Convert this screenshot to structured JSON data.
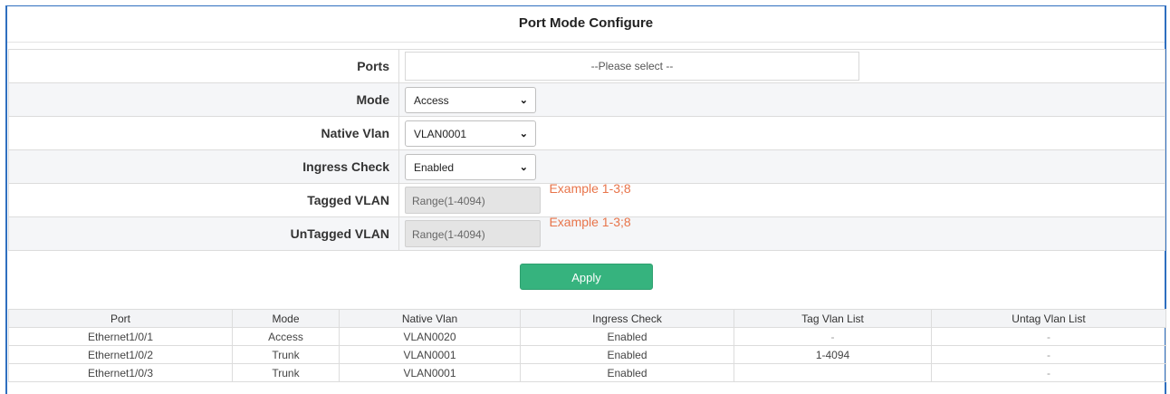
{
  "title": "Port Mode Configure",
  "form": {
    "ports": {
      "label": "Ports",
      "placeholder": "--Please select --"
    },
    "mode": {
      "label": "Mode",
      "value": "Access"
    },
    "native_vlan": {
      "label": "Native Vlan",
      "value": "VLAN0001"
    },
    "ingress_check": {
      "label": "Ingress Check",
      "value": "Enabled"
    },
    "tagged_vlan": {
      "label": "Tagged VLAN",
      "placeholder": "Range(1-4094)",
      "example": "Example 1-3;8"
    },
    "untagged_vlan": {
      "label": "UnTagged VLAN",
      "placeholder": "Range(1-4094)",
      "example": "Example 1-3;8"
    }
  },
  "apply_label": "Apply",
  "table": {
    "headers": [
      "Port",
      "Mode",
      "Native Vlan",
      "Ingress Check",
      "Tag Vlan List",
      "Untag Vlan List"
    ],
    "rows": [
      [
        "Ethernet1/0/1",
        "Access",
        "VLAN0020",
        "Enabled",
        "-",
        "-"
      ],
      [
        "Ethernet1/0/2",
        "Trunk",
        "VLAN0001",
        "Enabled",
        "1-4094",
        "-"
      ],
      [
        "Ethernet1/0/3",
        "Trunk",
        "VLAN0001",
        "Enabled",
        "",
        "-"
      ]
    ]
  },
  "colors": {
    "apply": "#36b37e",
    "example": "#e8744a",
    "frame": "#2f6fbf"
  },
  "icons": {
    "select_caret": "chevron-down-icon"
  }
}
